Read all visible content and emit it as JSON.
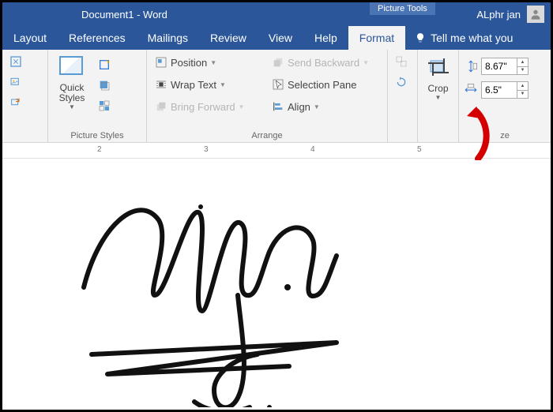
{
  "title": {
    "document": "Document1  -  Word",
    "context_tab": "Picture Tools",
    "user": "ALphr jan"
  },
  "tabs": {
    "layout": "Layout",
    "references": "References",
    "mailings": "Mailings",
    "review": "Review",
    "view": "View",
    "help": "Help",
    "format": "Format",
    "tellme": "Tell me what you"
  },
  "ribbon": {
    "picture_styles": {
      "label": "Picture Styles",
      "quick_styles": "Quick\nStyles"
    },
    "arrange": {
      "label": "Arrange",
      "position": "Position",
      "wrap_text": "Wrap Text",
      "bring_forward": "Bring Forward",
      "send_backward": "Send Backward",
      "selection_pane": "Selection Pane",
      "align": "Align"
    },
    "crop": {
      "label": "Crop"
    },
    "size": {
      "label": "ze",
      "height": "8.67\"",
      "width": "6.5\""
    }
  },
  "ruler": {
    "m2": "2",
    "m3": "3",
    "m4": "4",
    "m5": "5"
  }
}
